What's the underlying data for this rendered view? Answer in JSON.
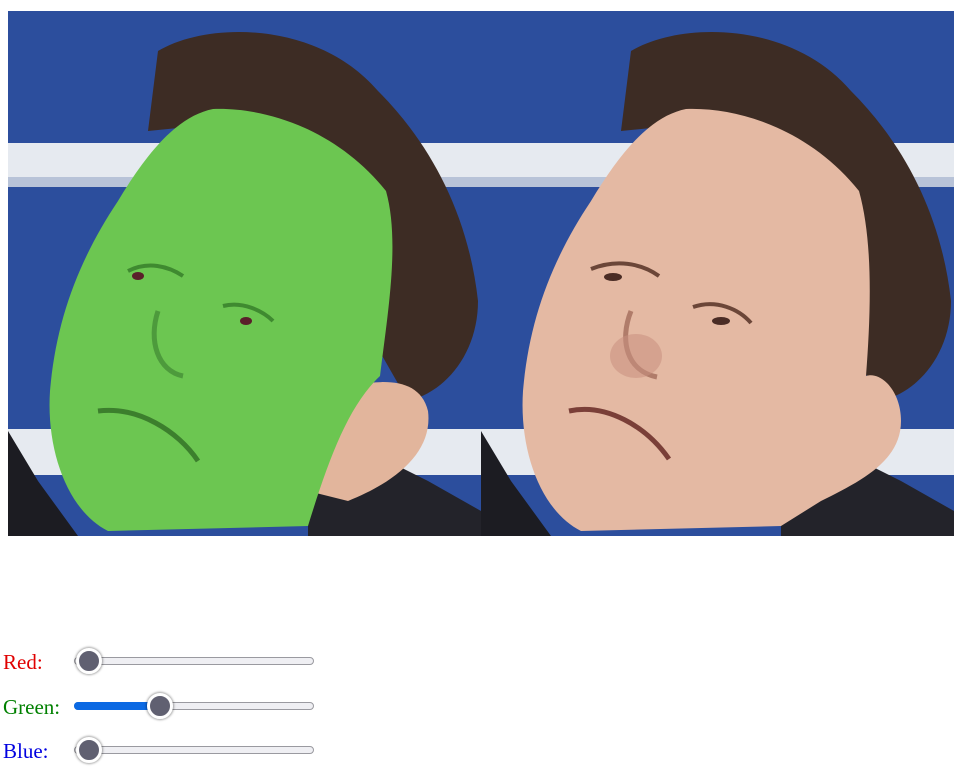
{
  "images": {
    "left": {
      "icon": "face-with-green-mask-overlay"
    },
    "right": {
      "icon": "original-face-photo"
    }
  },
  "colors": {
    "background_blue": "#2d50a0",
    "stripe_white": "#e8ecf2",
    "hair": "#3b2a22",
    "skin": "#e4b9a3",
    "mask_green": "#6cc651"
  },
  "controls": {
    "red": {
      "label": "Red:",
      "color": "#e00000",
      "min": 0,
      "max": 255,
      "value": 0
    },
    "green": {
      "label": "Green:",
      "color": "#008000",
      "min": 0,
      "max": 255,
      "value": 90
    },
    "blue": {
      "label": "Blue:",
      "color": "#0000e0",
      "min": 0,
      "max": 255,
      "value": 0
    }
  }
}
